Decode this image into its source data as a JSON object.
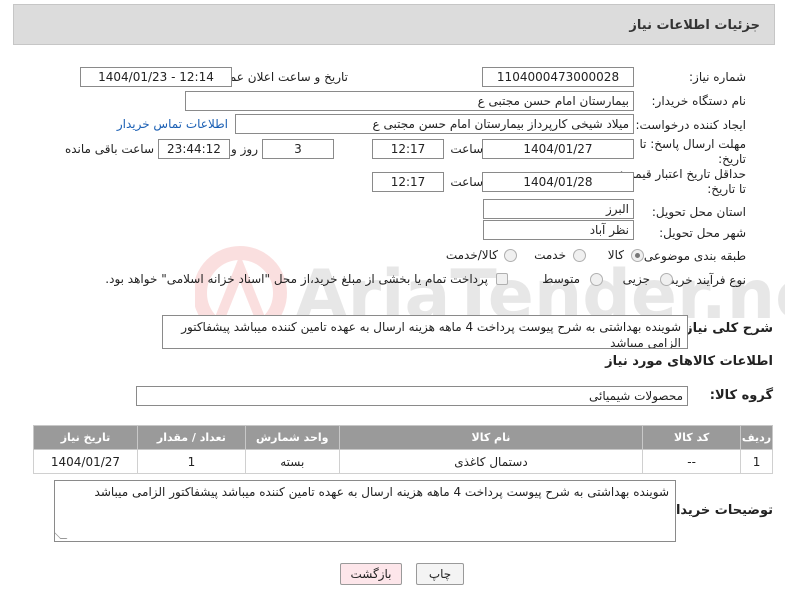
{
  "header": {
    "title": "جزئیات اطلاعات نیاز"
  },
  "form": {
    "need_number_label": "شماره نیاز:",
    "need_number": "1104000473000028",
    "announce_label": "تاریخ و ساعت اعلان عمومی:",
    "announce_value": "1404/01/23 - 12:14",
    "buyer_label": "نام دستگاه خریدار:",
    "buyer_value": "بیمارستان امام حسن مجتبی ع",
    "creator_label": "ایجاد کننده درخواست:",
    "creator_value": "میلاد شیخی کارپرداز بیمارستان امام حسن مجتبی ع",
    "contact_link": "اطلاعات تماس خریدار",
    "deadline_label_1": "مهلت ارسال پاسخ: تا",
    "deadline_label_2": "تاریخ:",
    "deadline_date": "1404/01/27",
    "time_label": "ساعت",
    "deadline_time": "12:17",
    "days_value": "3",
    "days_label": "روز و",
    "remaining_value": "23:44:12",
    "remaining_label": "ساعت باقی مانده",
    "validity_label_1": "حداقل تاریخ اعتبار قیمت:",
    "validity_label_2": "تا تاریخ:",
    "validity_date": "1404/01/28",
    "validity_time": "12:17",
    "province_label": "استان محل تحویل:",
    "province_value": "البرز",
    "city_label": "شهر محل تحویل:",
    "city_value": "نظر آباد",
    "category_label": "طبقه بندی موضوعی:",
    "category_options": [
      "کالا",
      "خدمت",
      "کالا/خدمت"
    ],
    "category_selected": "کالا",
    "process_label": "نوع فرآیند خرید :",
    "process_options": [
      "جزیی",
      "متوسط"
    ],
    "process_selected": "جزیی",
    "payment_note": "پرداخت تمام یا بخشی از مبلغ خرید،از محل \"اسناد خزانه اسلامی\" خواهد بود."
  },
  "description": {
    "label": "شرح کلی نیاز:",
    "value": "شوینده بهداشتی به شرح پیوست پرداخت 4 ماهه هزینه ارسال به عهده تامین کننده میباشد پیشفاکتور الزامی میباشد"
  },
  "goods": {
    "section_title": "اطلاعات کالاهای مورد نیاز",
    "group_label": "گروه کالا:",
    "group_value": "محصولات شیمیائی",
    "columns": [
      "ردیف",
      "کد کالا",
      "نام کالا",
      "واحد شمارش",
      "تعداد / مقدار",
      "تاریخ نیاز"
    ],
    "rows": [
      [
        "1",
        "--",
        "دستمال کاغذی",
        "بسته",
        "1",
        "1404/01/27"
      ]
    ]
  },
  "buyer_notes": {
    "label": "توضیحات خریدار:",
    "value": "شوینده بهداشتی به شرح پیوست پرداخت 4 ماهه هزینه ارسال به عهده تامین کننده میباشد پیشفاکتور الزامی میباشد"
  },
  "buttons": {
    "print": "چاپ",
    "back": "بازگشت"
  },
  "watermark": {
    "text": "AriaTender.neT"
  },
  "colors": {
    "back_button": "#fde6ea",
    "header_bg": "#dcdcdc",
    "table_header": "#9a9a9a",
    "link": "#1a5fb4"
  }
}
